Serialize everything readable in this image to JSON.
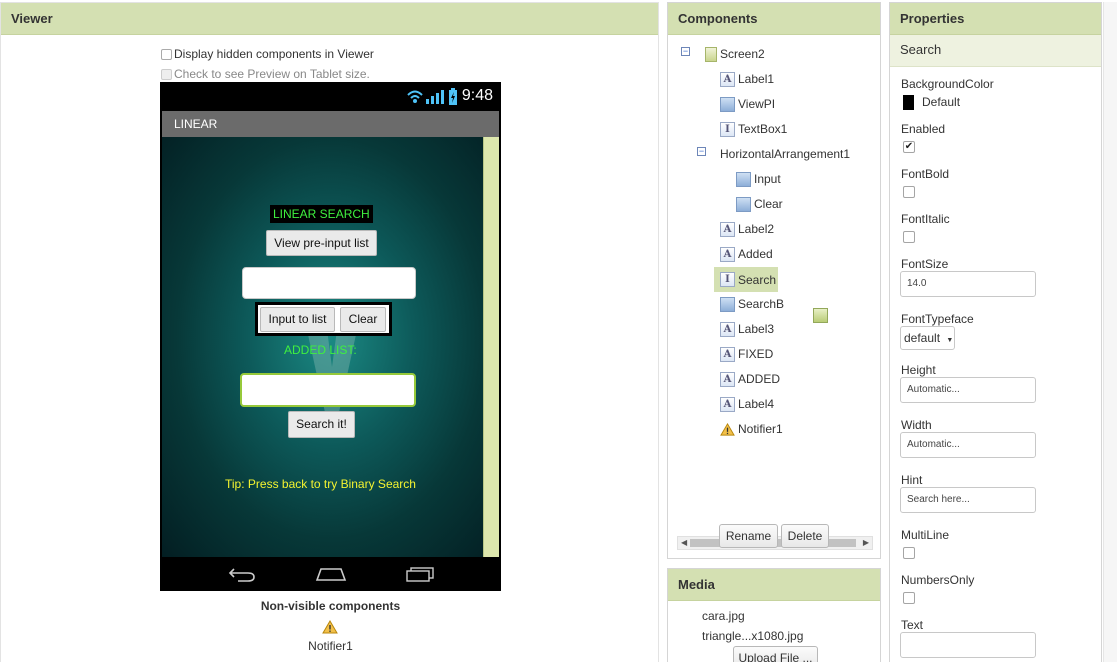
{
  "viewer": {
    "title": "Viewer",
    "display_hidden": "Display hidden components in Viewer",
    "tablet_preview": "Check to see Preview on Tablet size.",
    "phone": {
      "status_time": "9:48",
      "title_bar": "LINEAR",
      "linear_search_label": "LINEAR SEARCH",
      "view_preinput_btn": "View pre-input list",
      "input_btn": "Input to list",
      "clear_btn": "Clear",
      "added_list_label": "ADDED LIST:",
      "search_btn": "Search it!",
      "tip": "Tip: Press back to try Binary Search"
    },
    "nonvisible_title": "Non-visible components",
    "nonvisible_item": "Notifier1"
  },
  "components": {
    "title": "Components",
    "items": [
      {
        "label": "Screen2",
        "icon": "screen-icon"
      },
      {
        "label": "Label1",
        "icon": "label-icon"
      },
      {
        "label": "ViewPI",
        "icon": "button-icon"
      },
      {
        "label": "TextBox1",
        "icon": "textbox-icon"
      },
      {
        "label": "HorizontalArrangement1",
        "icon": "arrangement-icon"
      },
      {
        "label": "Input",
        "icon": "button-icon"
      },
      {
        "label": "Clear",
        "icon": "button-icon"
      },
      {
        "label": "Label2",
        "icon": "label-icon"
      },
      {
        "label": "Added",
        "icon": "label-icon"
      },
      {
        "label": "Search",
        "icon": "textbox-icon"
      },
      {
        "label": "SearchB",
        "icon": "button-icon"
      },
      {
        "label": "Label3",
        "icon": "label-icon"
      },
      {
        "label": "FIXED",
        "icon": "label-icon"
      },
      {
        "label": "ADDED",
        "icon": "label-icon"
      },
      {
        "label": "Label4",
        "icon": "label-icon"
      },
      {
        "label": "Notifier1",
        "icon": "warning-icon"
      }
    ],
    "rename": "Rename",
    "delete": "Delete"
  },
  "media": {
    "title": "Media",
    "files": [
      "cara.jpg",
      "triangle...x1080.jpg"
    ],
    "upload": "Upload File ..."
  },
  "properties": {
    "title": "Properties",
    "component": "Search",
    "background_color_label": "BackgroundColor",
    "background_color_value": "Default",
    "enabled_label": "Enabled",
    "fontbold_label": "FontBold",
    "fontitalic_label": "FontItalic",
    "fontsize_label": "FontSize",
    "fontsize_value": "14.0",
    "fonttypeface_label": "FontTypeface",
    "fonttypeface_value": "default",
    "height_label": "Height",
    "height_value": "Automatic...",
    "width_label": "Width",
    "width_value": "Automatic...",
    "hint_label": "Hint",
    "hint_value": "Search here...",
    "multiline_label": "MultiLine",
    "numbersonly_label": "NumbersOnly",
    "text_label": "Text"
  },
  "colors": {
    "header_green": "#d4e0b2",
    "selected_green": "#d4e0b2",
    "linear_title_green": "#3ff03f",
    "tip_yellow": "#f4f430"
  }
}
